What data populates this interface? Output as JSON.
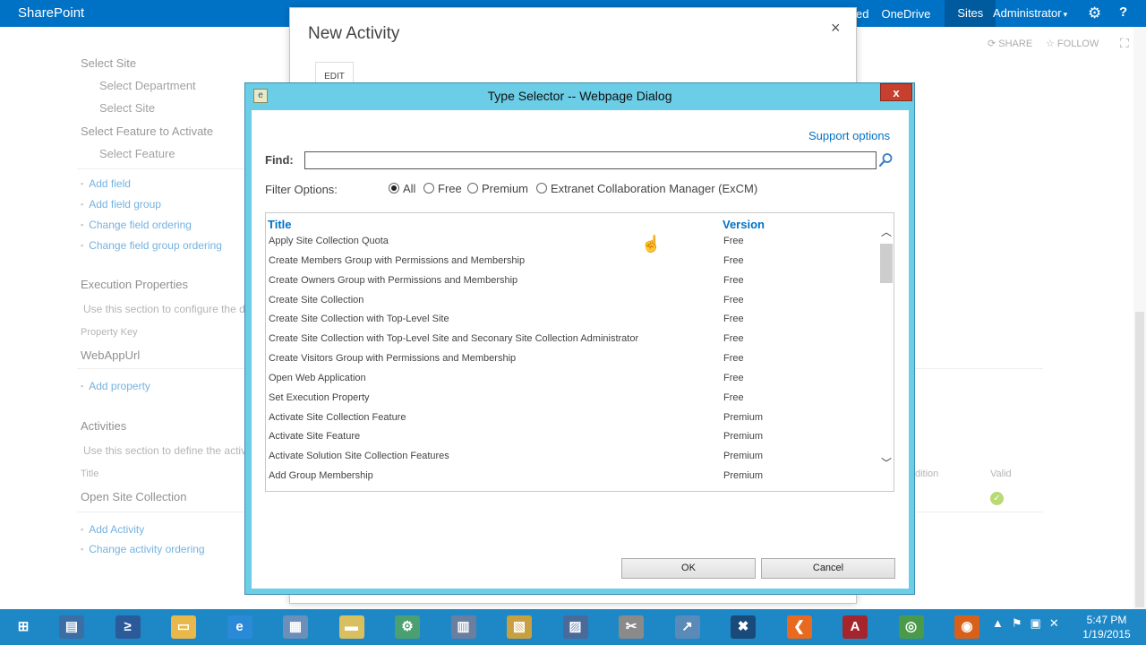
{
  "suitebar": {
    "brand": "SharePoint",
    "links_fragment": "ed",
    "links": [
      "OneDrive",
      "Sites"
    ],
    "user": "Administrator",
    "help": "?"
  },
  "page_actions": {
    "share": "SHARE",
    "follow": "FOLLOW"
  },
  "left": {
    "select_site": "Select Site",
    "select_department": "Select Department",
    "select_site_sub": "Select Site",
    "select_feature_to_activate": "Select Feature to Activate",
    "select_feature": "Select Feature",
    "field_links": [
      "Add field",
      "Add field group",
      "Change field ordering",
      "Change field group ordering"
    ],
    "execution_properties": "Execution Properties",
    "execution_hint": "Use this section to configure the de",
    "property_key_label": "Property Key",
    "property_key_value": "WebAppUrl",
    "add_property": "Add property",
    "activities": "Activities",
    "activities_hint": "Use this section to define the activi",
    "title_label": "Title",
    "activity_value": "Open Site Collection",
    "activity_links": [
      "Add Activity",
      "Change activity ordering"
    ]
  },
  "right": {
    "condition_fragment": "dition",
    "valid": "Valid"
  },
  "new_activity": {
    "title": "New Activity",
    "edit_tab": "EDIT",
    "close": "×"
  },
  "type_selector": {
    "title": "Type Selector -- Webpage Dialog",
    "close": "x",
    "support_options": "Support options",
    "find_label": "Find:",
    "find_value": "",
    "filter_label": "Filter Options:",
    "filters": [
      {
        "label": "All",
        "selected": true
      },
      {
        "label": "Free",
        "selected": false
      },
      {
        "label": "Premium",
        "selected": false
      },
      {
        "label": "Extranet Collaboration Manager (ExCM)",
        "selected": false
      }
    ],
    "columns": {
      "title": "Title",
      "version": "Version"
    },
    "rows": [
      {
        "title": "Apply Site Collection Quota",
        "version": "Free"
      },
      {
        "title": "Create Members Group with Permissions and Membership",
        "version": "Free"
      },
      {
        "title": "Create Owners Group with Permissions and Membership",
        "version": "Free"
      },
      {
        "title": "Create Site Collection",
        "version": "Free"
      },
      {
        "title": "Create Site Collection with Top-Level Site",
        "version": "Free"
      },
      {
        "title": "Create Site Collection with Top-Level Site and Seconary Site Collection Administrator",
        "version": "Free"
      },
      {
        "title": "Create Visitors Group with Permissions and Membership",
        "version": "Free"
      },
      {
        "title": "Open Web Application",
        "version": "Free"
      },
      {
        "title": "Set Execution Property",
        "version": "Free"
      },
      {
        "title": "Activate Site Collection Feature",
        "version": "Premium"
      },
      {
        "title": "Activate Site Feature",
        "version": "Premium"
      },
      {
        "title": "Activate Solution Site Collection Features",
        "version": "Premium"
      },
      {
        "title": "Add Group Membership",
        "version": "Premium"
      }
    ],
    "ok": "OK",
    "cancel": "Cancel"
  },
  "taskbar": {
    "apps": [
      {
        "name": "start-icon",
        "color": "#1e88c7"
      },
      {
        "name": "server-manager-icon",
        "color": "#3a6ea5"
      },
      {
        "name": "powershell-icon",
        "color": "#2a5a9a"
      },
      {
        "name": "file-explorer-icon",
        "color": "#e8b84a"
      },
      {
        "name": "internet-explorer-icon",
        "color": "#2a8ad8"
      },
      {
        "name": "control-panel-icon",
        "color": "#6a8fb8"
      },
      {
        "name": "notepad-icon",
        "color": "#d8c060"
      },
      {
        "name": "network-icon",
        "color": "#4aa070"
      },
      {
        "name": "registry-icon",
        "color": "#6a7fa0"
      },
      {
        "name": "sql-tools-icon",
        "color": "#c8a040"
      },
      {
        "name": "remote-desktop-icon",
        "color": "#4a6a9a"
      },
      {
        "name": "admin-tools-icon",
        "color": "#8a8a8a"
      },
      {
        "name": "sharepoint-designer-icon",
        "color": "#5a8ab8"
      },
      {
        "name": "visual-studio-tools-icon",
        "color": "#1a4a7a"
      },
      {
        "name": "custom-app-icon",
        "color": "#e86a20"
      },
      {
        "name": "access-icon",
        "color": "#a4262c"
      },
      {
        "name": "chrome-icon",
        "color": "#4a9a4a"
      },
      {
        "name": "firefox-icon",
        "color": "#d8601a"
      }
    ],
    "time": "5:47 PM",
    "date": "1/19/2015"
  }
}
